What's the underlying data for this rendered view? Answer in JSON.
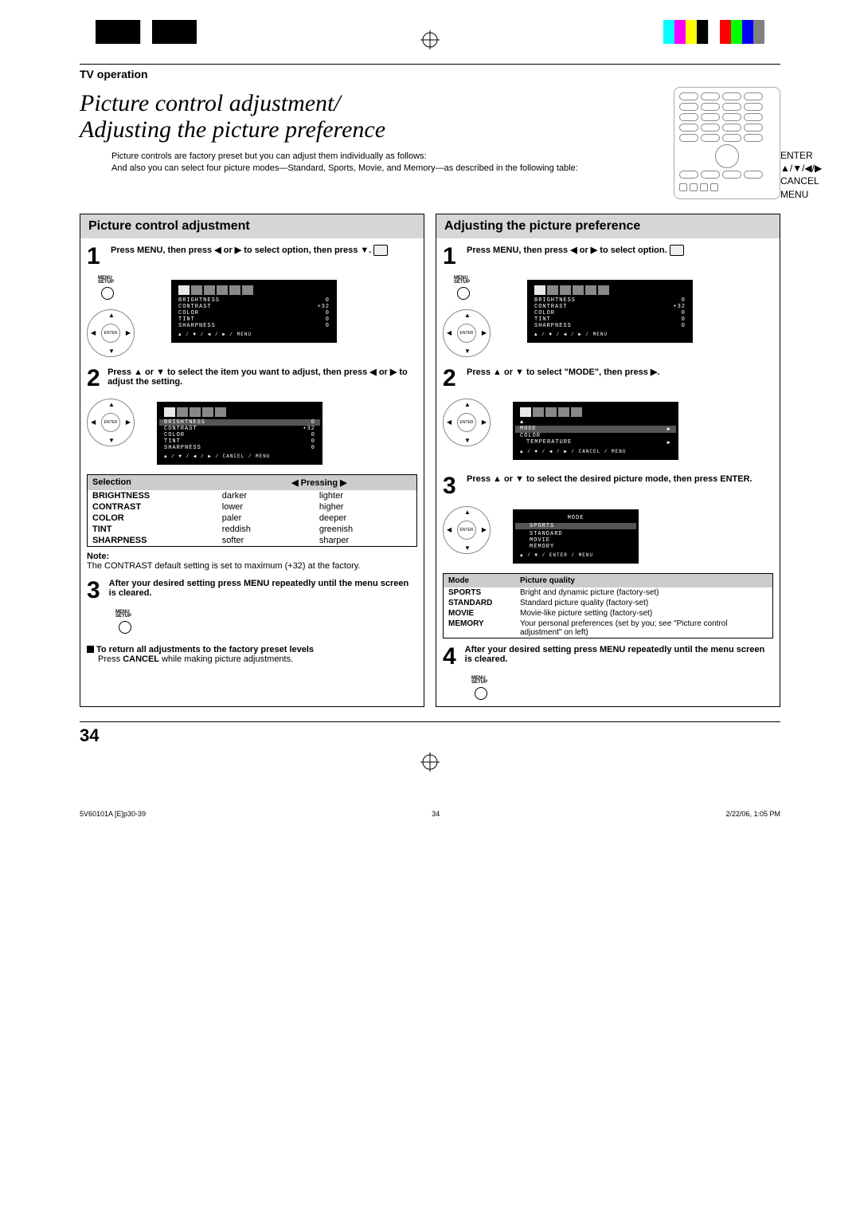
{
  "header": {
    "section": "TV operation"
  },
  "title": "Picture control adjustment/\nAdjusting the picture preference",
  "intro": {
    "p1": "Picture controls are factory preset but you can adjust them individually as follows:",
    "p2": "And also you can select four picture modes—Standard, Sports, Movie, and Memory—as described in the following table:"
  },
  "remote_labels": {
    "enter": "ENTER",
    "arrows": "▲/▼/◀/▶",
    "cancel": "CANCEL",
    "menu": "MENU"
  },
  "left_col": {
    "heading": "Picture control adjustment",
    "step1": "Press MENU, then press ◀ or ▶ to select        option, then press ▼.",
    "step2": "Press ▲ or ▼ to select the item you want to adjust, then press ◀ or ▶ to adjust the setting.",
    "step3": "After your desired setting press MENU repeatedly until the menu screen is cleared.",
    "selection_table": {
      "head": [
        "Selection",
        "◀  Pressing  ▶"
      ],
      "rows": [
        [
          "BRIGHTNESS",
          "darker",
          "lighter"
        ],
        [
          "CONTRAST",
          "lower",
          "higher"
        ],
        [
          "COLOR",
          "paler",
          "deeper"
        ],
        [
          "TINT",
          "reddish",
          "greenish"
        ],
        [
          "SHARPNESS",
          "softer",
          "sharper"
        ]
      ]
    },
    "note_label": "Note:",
    "note_text": "The CONTRAST default setting is set to maximum (+32) at the factory.",
    "return_head": "To return all adjustments to the factory preset levels",
    "return_body": "Press CANCEL while making picture adjustments.",
    "cancel_bold": "CANCEL"
  },
  "right_col": {
    "heading": "Adjusting the picture preference",
    "step1": "Press MENU, then press ◀ or ▶ to select        option.",
    "step2": "Press ▲ or ▼ to select \"MODE\", then press ▶.",
    "step3": "Press ▲ or ▼ to select the desired picture mode, then press ENTER.",
    "step4": "After your desired setting press MENU repeatedly until the menu screen is cleared.",
    "mode_table": {
      "head": [
        "Mode",
        "Picture quality"
      ],
      "rows": [
        [
          "SPORTS",
          "Bright and dynamic picture (factory-set)"
        ],
        [
          "STANDARD",
          "Standard picture quality (factory-set)"
        ],
        [
          "MOVIE",
          "Movie-like picture setting (factory-set)"
        ],
        [
          "MEMORY",
          "Your personal preferences (set by you; see \"Picture control adjustment\" on left)"
        ]
      ]
    }
  },
  "osd1": {
    "brightness": "BRIGHTNESS",
    "brightness_v": "0",
    "contrast": "CONTRAST",
    "contrast_v": "+32",
    "color": "COLOR",
    "color_v": "0",
    "tint": "TINT",
    "tint_v": "0",
    "sharpness": "SHARPNESS",
    "sharpness_v": "0",
    "foot": "▲ / ▼ / ◀ / ▶ / MENU"
  },
  "osd2": {
    "foot": "▲ / ▼ / ◀ / ▶ / CANCEL / MENU"
  },
  "osd_mode": {
    "mode": "MODE",
    "mode_arrow": "▶",
    "color": "COLOR",
    "temp": "TEMPERATURE",
    "temp_arrow": "▶",
    "foot": "▲ / ▼ / ◀ / ▶ / CANCEL / MENU"
  },
  "osd_modelist": {
    "title": "MODE",
    "items": [
      "SPORTS",
      "STANDARD",
      "MOVIE",
      "MEMORY"
    ],
    "foot": "▲ / ▼ / ENTER / MENU"
  },
  "menu_setup": "MENU\nSETUP",
  "enter_label": "ENTER",
  "page_number": "34",
  "footer": {
    "file": "5V60101A [E]p30-39",
    "page": "34",
    "date": "2/22/06, 1:05 PM"
  }
}
